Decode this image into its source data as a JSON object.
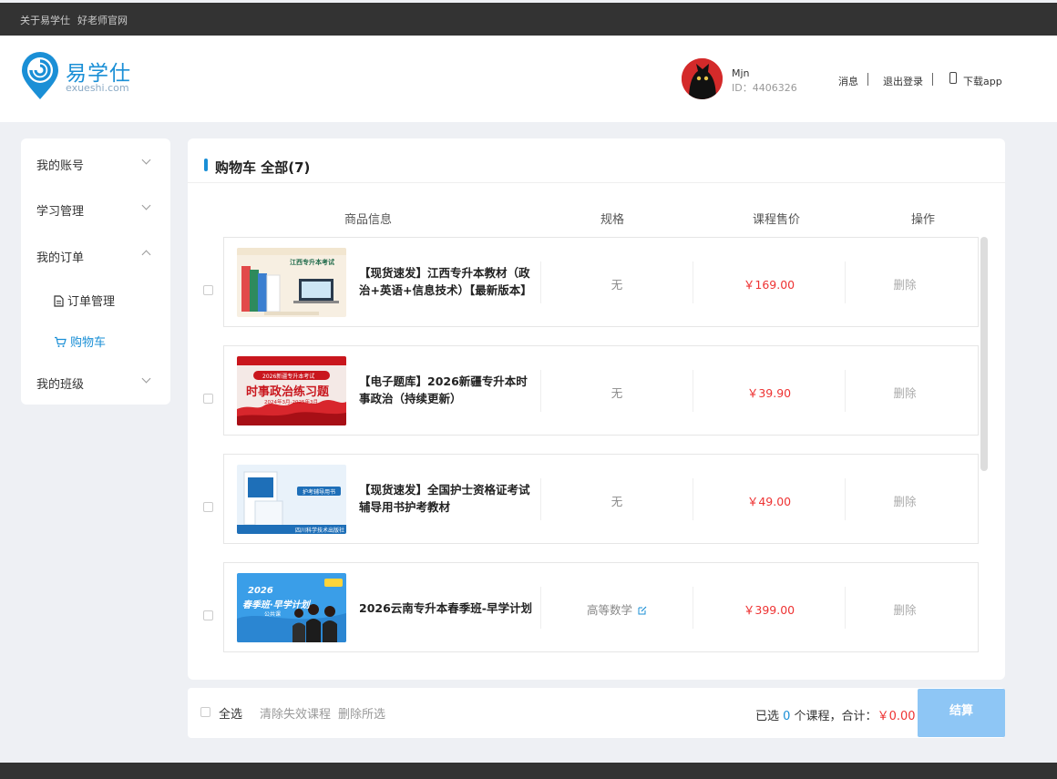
{
  "topbar": {
    "about": "关于易学仕",
    "teachers": "好老师官网"
  },
  "brand": {
    "name_cn": "易学仕",
    "name_en": "exueshi.com"
  },
  "user": {
    "name": "Mjn",
    "id_label": "ID：4406326"
  },
  "header_links": {
    "messages": "消息",
    "logout": "退出登录",
    "download": "下载app"
  },
  "sidebar": {
    "account": "我的账号",
    "study": "学习管理",
    "orders": "我的订单",
    "order_manage": "订单管理",
    "cart": "购物车",
    "classes": "我的班级"
  },
  "cart": {
    "title": "购物车 全部(7)",
    "columns": {
      "info": "商品信息",
      "spec": "规格",
      "price": "课程售价",
      "action": "操作"
    },
    "items": [
      {
        "name": "【现货速发】江西专升本教材（政治+英语+信息技术）【最新版本】",
        "spec": "无",
        "price": "￥169.00",
        "action": "删除"
      },
      {
        "name": "【电子题库】2026新疆专升本时事政治（持续更新）",
        "spec": "无",
        "price": "￥39.90",
        "action": "删除"
      },
      {
        "name": "【现货速发】全国护士资格证考试辅导用书护考教材",
        "spec": "无",
        "price": "￥49.00",
        "action": "删除"
      },
      {
        "name": "2026云南专升本春季班-早学计划",
        "spec": "高等数学",
        "price": "￥399.00",
        "action": "删除"
      }
    ],
    "thumbs": {
      "t1": "江西专升本考试",
      "t2_top": "2026新疆专升本考试",
      "t2_main": "时事政治练习题",
      "t2_sub": "2024年3月-2025年3月",
      "t3_tag": "护考辅导用书",
      "t3_pub": "四川科学技术出版社",
      "t4_year": "2026",
      "t4_main": "春季班·早学计划",
      "t4_sub": "公共课"
    }
  },
  "footer": {
    "select_all": "全选",
    "clear_invalid": "清除失效课程",
    "delete_selected": "删除所选",
    "selected_prefix": "已选 ",
    "selected_count": "0",
    "selected_suffix": " 个课程，合计：",
    "total": "￥0.00",
    "checkout": "结算"
  },
  "colors": {
    "brand_blue": "#1a8fd6",
    "price_red": "#e33333",
    "checkout_bg": "#8ec6f5"
  }
}
